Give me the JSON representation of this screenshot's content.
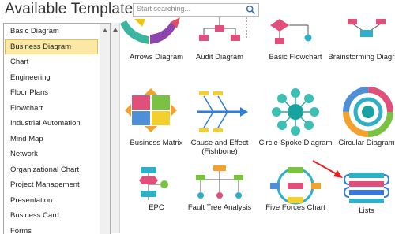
{
  "header": {
    "title": "Available Templates",
    "search_placeholder": "Start searching..."
  },
  "icons": {
    "search": "search-icon",
    "scroll_up": "scroll-up-arrow-icon"
  },
  "sidebar": {
    "selected_index": 1,
    "items": [
      {
        "label": "Basic Diagram"
      },
      {
        "label": "Business Diagram"
      },
      {
        "label": "Chart"
      },
      {
        "label": "Engineering"
      },
      {
        "label": "Floor Plans"
      },
      {
        "label": "Flowchart"
      },
      {
        "label": "Industrial Automation"
      },
      {
        "label": "Mind Map"
      },
      {
        "label": "Network"
      },
      {
        "label": "Organizational Chart"
      },
      {
        "label": "Project Management"
      },
      {
        "label": "Presentation"
      },
      {
        "label": "Business Card"
      },
      {
        "label": "Forms"
      }
    ]
  },
  "templates": [
    {
      "label": "Arrows Diagram"
    },
    {
      "label": "Audit Diagram"
    },
    {
      "label": "Basic Flowchart"
    },
    {
      "label": "Brainstorming Diagram"
    },
    {
      "label": "Business Matrix"
    },
    {
      "label": "Cause and Effect (Fishbone)"
    },
    {
      "label": "Circle-Spoke Diagram"
    },
    {
      "label": "Circular Diagram"
    },
    {
      "label": "EPC"
    },
    {
      "label": "Fault Tree Analysis"
    },
    {
      "label": "Five Forces Chart"
    },
    {
      "label": "Lists"
    }
  ],
  "colors": {
    "selection_fill": "#fbe8a4",
    "selection_border": "#e2be5a",
    "annotation_arrow": "#e8201e"
  }
}
